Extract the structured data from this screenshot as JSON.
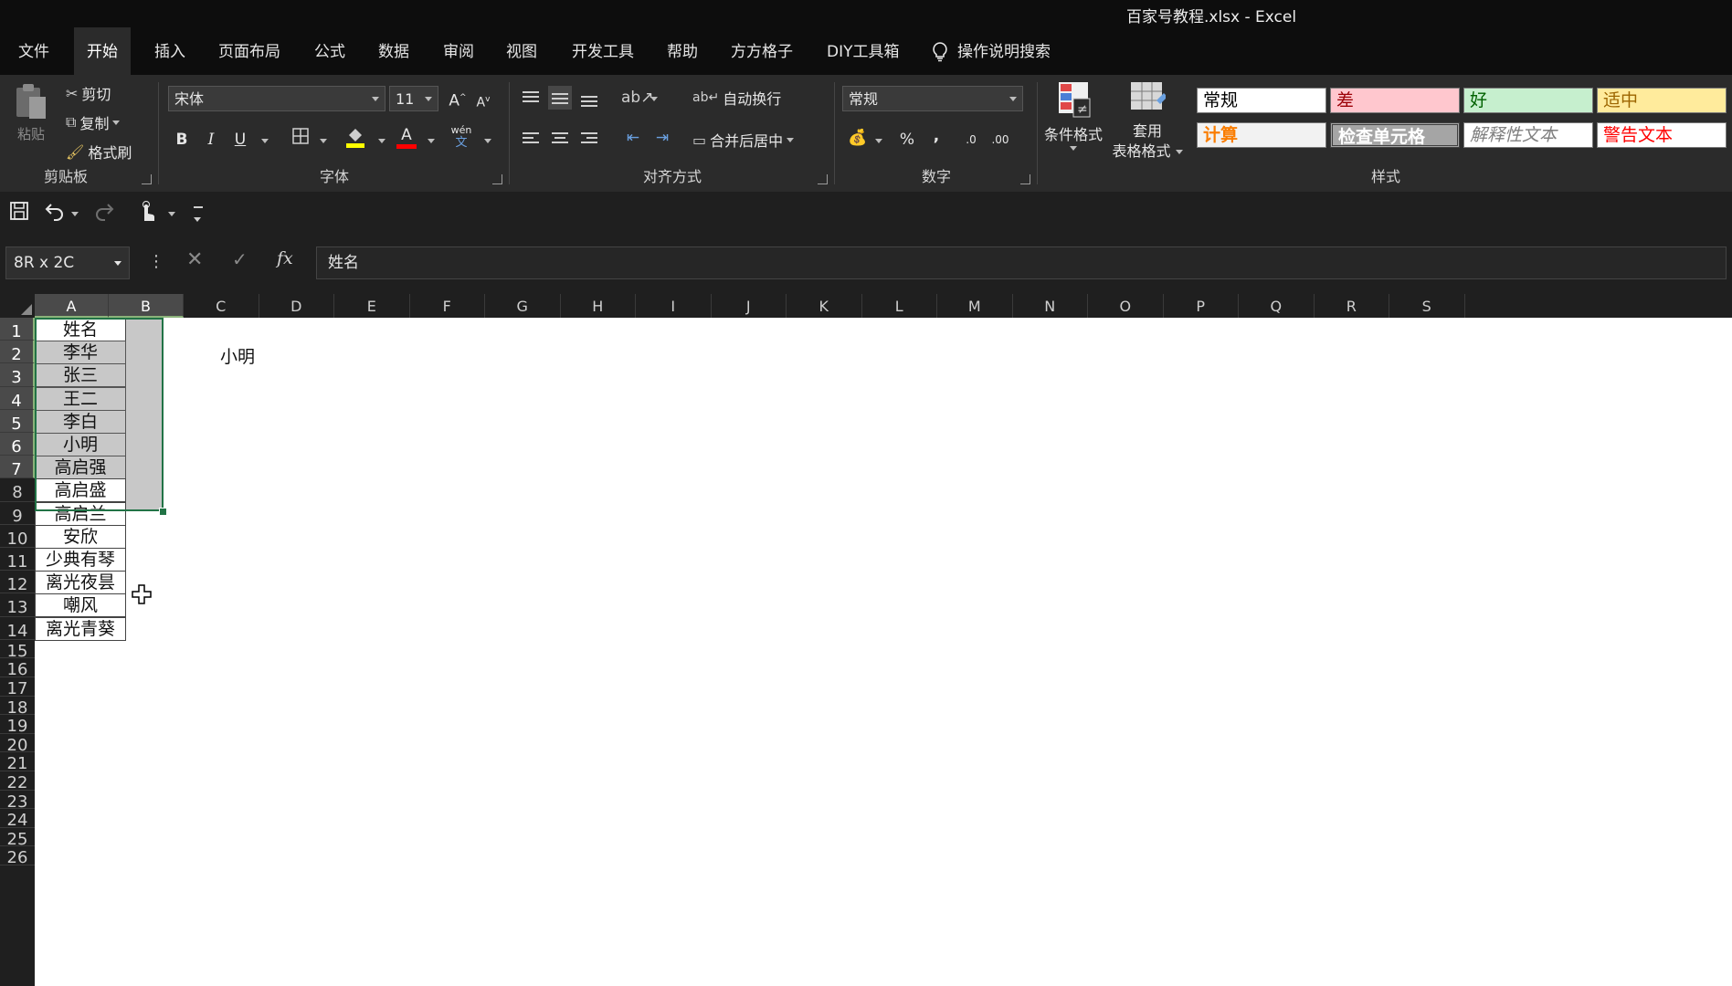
{
  "window": {
    "title": "百家号教程.xlsx  -  Excel"
  },
  "tabs": [
    {
      "label": "文件",
      "active": false
    },
    {
      "label": "开始",
      "active": true
    },
    {
      "label": "插入",
      "active": false
    },
    {
      "label": "页面布局",
      "active": false
    },
    {
      "label": "公式",
      "active": false
    },
    {
      "label": "数据",
      "active": false
    },
    {
      "label": "审阅",
      "active": false
    },
    {
      "label": "视图",
      "active": false
    },
    {
      "label": "开发工具",
      "active": false
    },
    {
      "label": "帮助",
      "active": false
    },
    {
      "label": "方方格子",
      "active": false
    },
    {
      "label": "DIY工具箱",
      "active": false
    }
  ],
  "tell_me": {
    "label": "操作说明搜索",
    "icon": "lightbulb-icon"
  },
  "ribbon": {
    "clipboard": {
      "label": "剪贴板",
      "paste_label": "粘贴",
      "cut_label": "剪切",
      "copy_label": "复制",
      "format_painter_label": "格式刷"
    },
    "font": {
      "label": "字体",
      "font_name": "宋体",
      "font_size": "11",
      "grow": "A",
      "shrink": "A",
      "bold": "B",
      "italic": "I",
      "underline": "U",
      "phonetic": "wén",
      "font_color_letter": "A"
    },
    "alignment": {
      "label": "对齐方式",
      "wrap_text": "自动换行",
      "merge_center": "合并后居中"
    },
    "number": {
      "label": "数字",
      "format": "常规",
      "percent": "%",
      "comma": ",",
      "inc_decimal": ".0",
      "dec_decimal": ".00"
    },
    "styles": {
      "label": "样式",
      "conditional_formatting": "条件格式",
      "format_as_table_line1": "套用",
      "format_as_table_line2": "表格格式",
      "cells": [
        {
          "label": "常规",
          "bg": "#ffffff",
          "fg": "#000000"
        },
        {
          "label": "差",
          "bg": "#ffc7ce",
          "fg": "#9c0006"
        },
        {
          "label": "好",
          "bg": "#c6efce",
          "fg": "#006100"
        },
        {
          "label": "适中",
          "bg": "#ffeb9c",
          "fg": "#9c6500"
        },
        {
          "label": "计算",
          "bg": "#f2f2f2",
          "fg": "#fa7d00"
        },
        {
          "label": "检查单元格",
          "bg": "#a5a5a5",
          "fg": "#ffffff"
        },
        {
          "label": "解释性文本",
          "bg": "#ffffff",
          "fg": "#7f7f7f"
        },
        {
          "label": "警告文本",
          "bg": "#ffffff",
          "fg": "#ff0000"
        }
      ]
    }
  },
  "formula_bar": {
    "name_box": "8R x 2C",
    "fx": "fx",
    "content": "姓名"
  },
  "sheet": {
    "columns": [
      "A",
      "B",
      "C",
      "D",
      "E",
      "F",
      "G",
      "H",
      "I",
      "J",
      "K",
      "L",
      "M",
      "N",
      "O",
      "P",
      "Q",
      "R",
      "S"
    ],
    "rows": [
      "1",
      "2",
      "3",
      "4",
      "5",
      "6",
      "7",
      "8",
      "9",
      "10",
      "11",
      "12",
      "13",
      "14",
      "15",
      "16",
      "17",
      "18",
      "19",
      "20",
      "21",
      "22",
      "23",
      "24",
      "25",
      "26"
    ],
    "column_a": [
      "姓名",
      "李华",
      "张三",
      "王二",
      "李白",
      "小明",
      "高启强",
      "高启盛",
      "高启兰",
      "安欣",
      "少典有琴",
      "离光夜昙",
      "嘲风",
      "离光青葵"
    ],
    "c2_text": "小明",
    "selection": "A1:B7",
    "accent": "#217346"
  }
}
